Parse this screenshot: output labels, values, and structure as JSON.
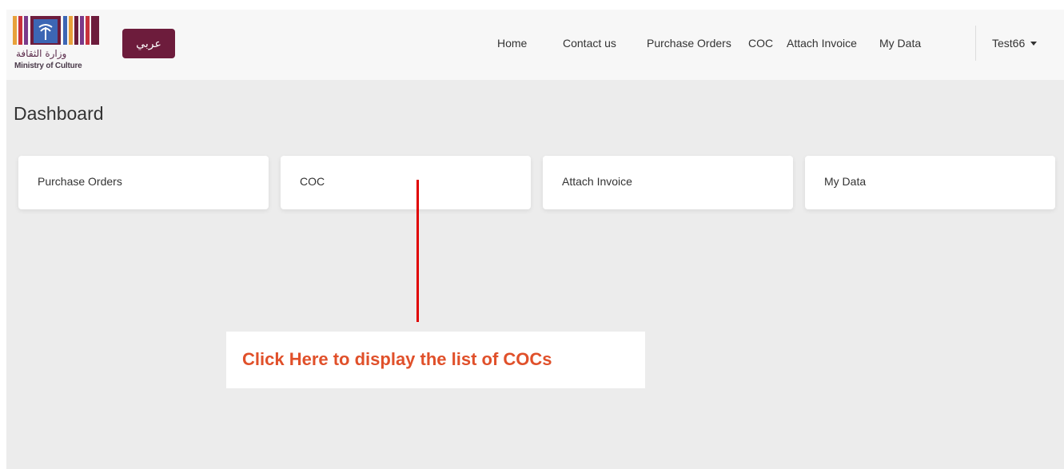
{
  "brand": {
    "logo_arabic": "وزارة الثقافة",
    "logo_english": "Ministry of Culture",
    "colors": {
      "bar_orange": "#e8a13a",
      "bar_red": "#c8323c",
      "bar_maroon": "#6d1c3c",
      "bar_blue": "#3c66b4",
      "bar_purple": "#7a3a8a"
    }
  },
  "language_button": "عربي",
  "nav": {
    "links": [
      "Home",
      "Contact us",
      "Purchase Orders",
      "COC",
      "Attach Invoice",
      "My Data"
    ],
    "user": "Test66"
  },
  "page_title": "Dashboard",
  "cards": [
    "Purchase Orders",
    "COC",
    "Attach Invoice",
    "My Data"
  ],
  "annotation": {
    "text": "Click Here to display the list of COCs",
    "color": "#e0502a",
    "line_color": "#e00000"
  }
}
